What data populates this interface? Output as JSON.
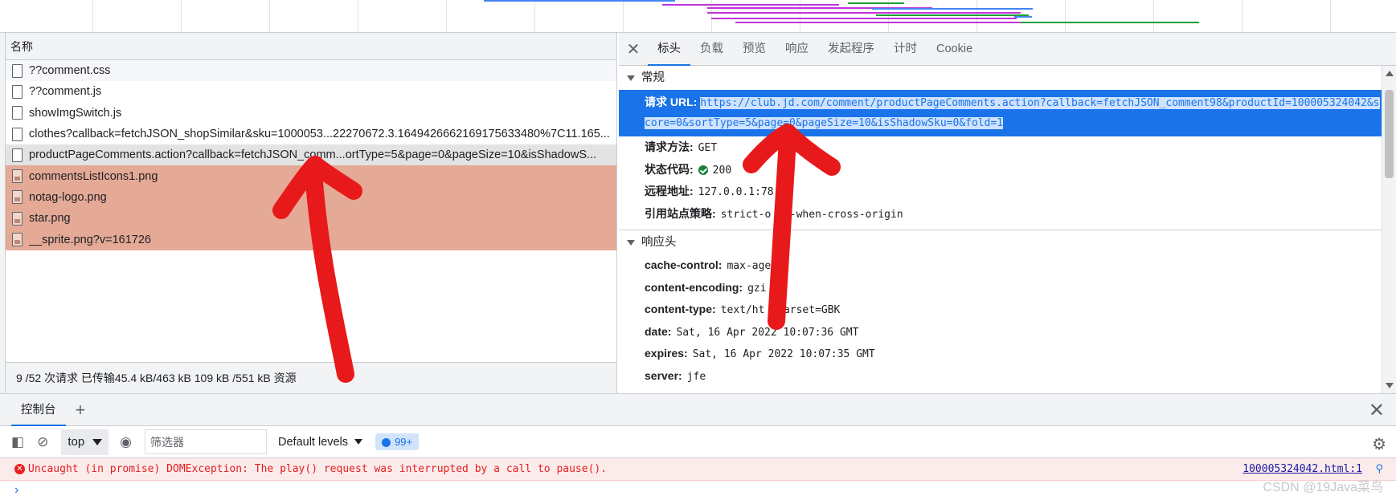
{
  "network_list": {
    "header": "名称",
    "rows": [
      {
        "name": "??comment.css",
        "kind": "doc",
        "state": "even"
      },
      {
        "name": "??comment.js",
        "kind": "doc",
        "state": "odd"
      },
      {
        "name": "showImgSwitch.js",
        "kind": "doc",
        "state": "odd"
      },
      {
        "name": "clothes?callback=fetchJSON_shopSimilar&sku=1000053...22270672.3.1649426662169175633480%7C11.165...",
        "kind": "doc",
        "state": "odd"
      },
      {
        "name": "productPageComments.action?callback=fetchJSON_comm...ortType=5&page=0&pageSize=10&isShadowS...",
        "kind": "doc",
        "state": "selected"
      },
      {
        "name": "commentsListIcons1.png",
        "kind": "img",
        "state": "img"
      },
      {
        "name": "notag-logo.png",
        "kind": "img",
        "state": "img"
      },
      {
        "name": "star.png",
        "kind": "img",
        "state": "img"
      },
      {
        "name": "__sprite.png?v=161726",
        "kind": "img",
        "state": "img"
      }
    ],
    "status": "9 /52 次请求  已传输45.4 kB/463 kB  109 kB /551 kB 资源"
  },
  "details": {
    "tabs": [
      "标头",
      "负载",
      "预览",
      "响应",
      "发起程序",
      "计时",
      "Cookie"
    ],
    "active_tab": "标头",
    "general": {
      "title": "常规",
      "request_url_label": "请求 URL:",
      "request_url": "https://club.jd.com/comment/productPageComments.action?callback=fetchJSON_comment98&productId=100005324042&score=0&sortType=5&page=0&pageSize=10&isShadowSku=0&fold=1",
      "method_label": "请求方法:",
      "method": "GET",
      "status_label": "状态代码:",
      "status": "200",
      "remote_label": "远程地址:",
      "remote": "127.0.0.1:78",
      "referrer_label": "引用站点策略:",
      "referrer": "strict-o    in-when-cross-origin"
    },
    "response_headers": {
      "title": "响应头",
      "items": [
        {
          "key": "cache-control:",
          "value": "max-age"
        },
        {
          "key": "content-encoding:",
          "value": "gzi"
        },
        {
          "key": "content-type:",
          "value": "text/ht    charset=GBK"
        },
        {
          "key": "date:",
          "value": "Sat, 16 Apr 2022 10:07:36 GMT"
        },
        {
          "key": "expires:",
          "value": "Sat, 16 Apr 2022 10:07:35 GMT"
        },
        {
          "key": "server:",
          "value": "jfe"
        }
      ]
    }
  },
  "console": {
    "tab_label": "控制台",
    "context": "top",
    "filter_placeholder": "筛选器",
    "levels": "Default levels",
    "issues_badge": "99+",
    "error_message": "Uncaught (in promise) DOMException: The play() request was interrupted by a call to pause().",
    "error_source": "100005324042.html:1",
    "prompt": "›"
  },
  "watermark": "CSDN @19Java菜鸟",
  "colors": {
    "accent": "#1a73e8",
    "image_row": "#e4aa96",
    "annotation_arrow": "#e8191b",
    "error_text": "#e51f1f"
  }
}
